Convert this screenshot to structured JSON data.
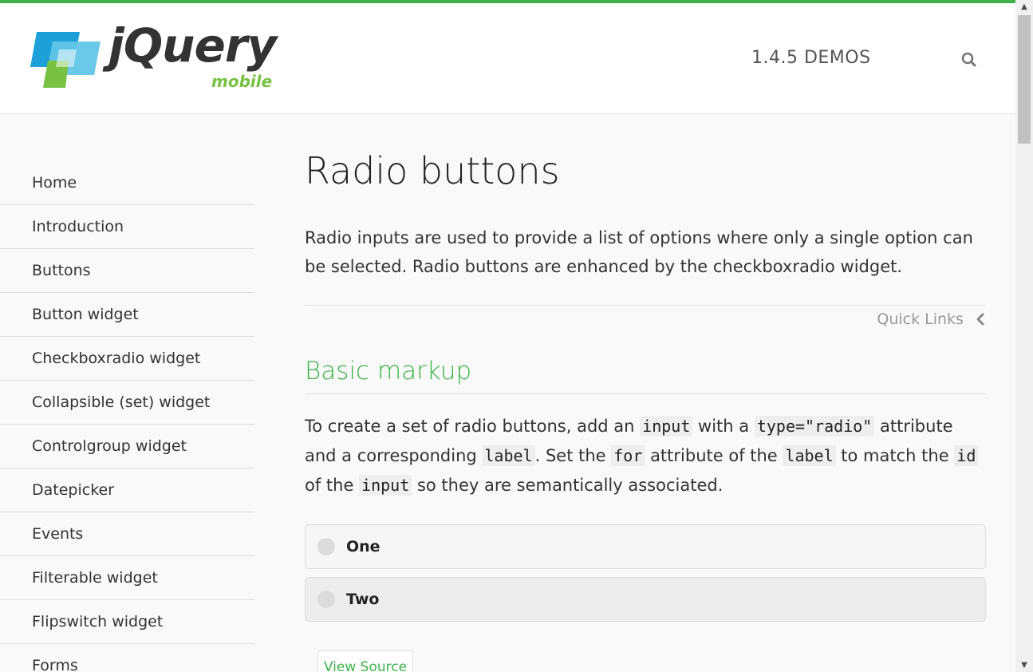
{
  "header": {
    "logo_text": "jQuery",
    "logo_sub": "mobile",
    "version": "1.4.5 DEMOS",
    "search_icon": "search-icon"
  },
  "colors": {
    "accent": "#3eb249",
    "logo_blue": "#1d9fd8",
    "logo_light_blue": "#62c6e8",
    "logo_green": "#78c143"
  },
  "sidebar": {
    "items": [
      {
        "label": "Home"
      },
      {
        "label": "Introduction"
      },
      {
        "label": "Buttons"
      },
      {
        "label": "Button widget"
      },
      {
        "label": "Checkboxradio widget"
      },
      {
        "label": "Collapsible (set) widget"
      },
      {
        "label": "Controlgroup widget"
      },
      {
        "label": "Datepicker"
      },
      {
        "label": "Events"
      },
      {
        "label": "Filterable widget"
      },
      {
        "label": "Flipswitch widget"
      },
      {
        "label": "Forms"
      }
    ]
  },
  "main": {
    "title": "Radio buttons",
    "intro": "Radio inputs are used to provide a list of options where only a single option can be selected. Radio buttons are enhanced by the checkboxradio widget.",
    "quick_links": "Quick Links",
    "section_title": "Basic markup",
    "section_text": {
      "t1": "To create a set of radio buttons, add an ",
      "c1": "input",
      "t2": " with a ",
      "c2": "type=\"radio\"",
      "t3": " attribute and a corresponding ",
      "c3": "label",
      "t4": ". Set the ",
      "c4": "for",
      "t5": " attribute of the ",
      "c5": "label",
      "t6": " to match the ",
      "c6": "id",
      "t7": " of the ",
      "c7": "input",
      "t8": " so they are semantically associated."
    },
    "radios": [
      {
        "label": "One"
      },
      {
        "label": "Two"
      }
    ],
    "view_source": "View Source"
  }
}
